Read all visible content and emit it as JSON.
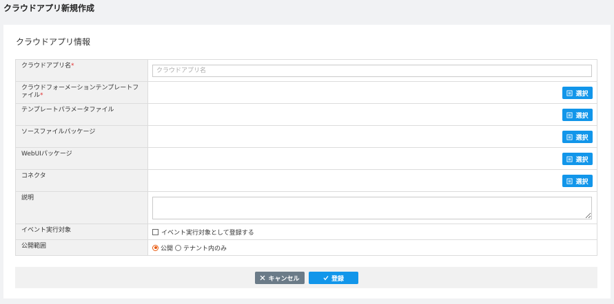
{
  "page": {
    "title": "クラウドアプリ新規作成"
  },
  "section": {
    "title": "クラウドアプリ情報"
  },
  "form": {
    "app_name": {
      "label": "クラウドアプリ名",
      "required_mark": "*",
      "placeholder": "クラウドアプリ名",
      "value": ""
    },
    "cf_template": {
      "label_line1": "クラウドフォーメーションテンプレートフ",
      "label_line2": "ァイル",
      "required_mark": "*",
      "button_label": "選択"
    },
    "template_param": {
      "label": "テンプレートパラメータファイル",
      "button_label": "選択"
    },
    "source_package": {
      "label": "ソースファイルパッケージ",
      "button_label": "選択"
    },
    "webui_package": {
      "label": "WebUIパッケージ",
      "button_label": "選択"
    },
    "connector": {
      "label": "コネクタ",
      "button_label": "選択"
    },
    "description": {
      "label": "説明",
      "value": ""
    },
    "event_target": {
      "label": "イベント実行対象",
      "checkbox_label": "イベント実行対象として登録する",
      "checked": false
    },
    "visibility": {
      "label": "公開範囲",
      "options": [
        {
          "label": "公開",
          "selected": true
        },
        {
          "label": "テナント内のみ",
          "selected": false
        }
      ]
    }
  },
  "actions": {
    "cancel_label": "キャンセル",
    "submit_label": "登録"
  },
  "colors": {
    "primary": "#1296ea",
    "secondary": "#6b7b88",
    "required": "#e03131",
    "radio_selected": "#e8590c"
  },
  "icons": {
    "select_button": "document-list-icon",
    "cancel": "close-icon",
    "submit": "check-icon"
  }
}
